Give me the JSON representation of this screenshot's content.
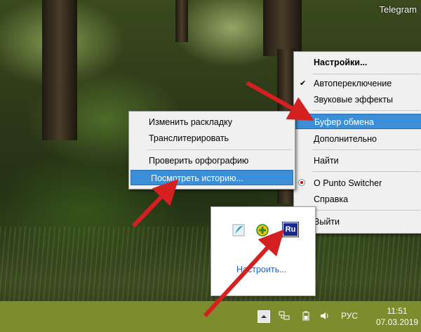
{
  "desktop": {
    "overlay_app": "Telegram"
  },
  "main_menu": {
    "items": [
      {
        "label": "Настройки...",
        "bold": true
      },
      {
        "label": "Автопереключение",
        "checked": true
      },
      {
        "label": "Звуковые эффекты"
      },
      {
        "label": "Буфер обмена",
        "highlighted": true
      },
      {
        "label": "Дополнительно"
      },
      {
        "label": "Найти"
      },
      {
        "label": "О Punto Switcher",
        "icon": "punto-icon"
      },
      {
        "label": "Справка"
      },
      {
        "label": "Выйти"
      }
    ]
  },
  "sub_menu": {
    "items": [
      {
        "label": "Изменить раскладку"
      },
      {
        "label": "Транслитерировать"
      },
      {
        "label": "Проверить орфографию"
      },
      {
        "label": "Посмотреть историю...",
        "highlighted": true
      }
    ]
  },
  "tray_popup": {
    "icons": [
      "app-icon-feather",
      "app-icon-plus",
      "punto-ru-icon"
    ],
    "ru_label": "Ru",
    "customize_label": "Настроить..."
  },
  "taskbar": {
    "icons": [
      "show-hidden-icons-icon",
      "network-icon",
      "battery-icon",
      "volume-icon"
    ],
    "language": "РУС",
    "time": "11:51",
    "date": "07.03.2019"
  },
  "colors": {
    "highlight": "#3c8fd6",
    "taskbar": "#7d8c2c",
    "arrow": "#d42020"
  }
}
